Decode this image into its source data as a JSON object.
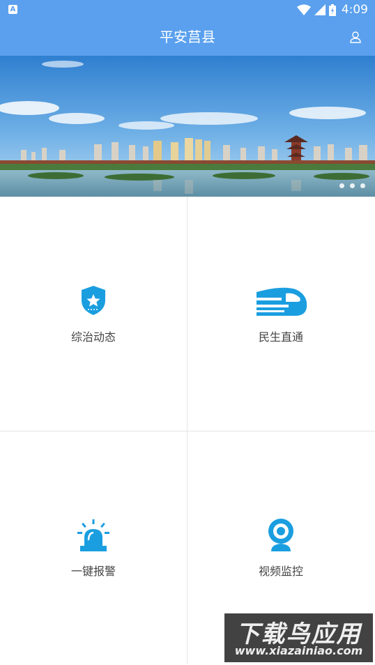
{
  "status_bar": {
    "time": "4:09",
    "app_indicator": "A"
  },
  "header": {
    "title": "平安莒县",
    "user_icon": "user-icon"
  },
  "banner": {
    "slides": 3,
    "active_slide": 1
  },
  "grid": {
    "items": [
      {
        "label": "综治动态",
        "icon": "shield-star-icon"
      },
      {
        "label": "民生直通",
        "icon": "train-icon"
      },
      {
        "label": "一键报警",
        "icon": "alarm-light-icon"
      },
      {
        "label": "视频监控",
        "icon": "webcam-icon"
      }
    ]
  },
  "watermark": {
    "title": "下载鸟应用",
    "url": "www.xiazainiao.com"
  },
  "colors": {
    "primary": "#5aa0ee",
    "icon": "#1a9ee0"
  }
}
